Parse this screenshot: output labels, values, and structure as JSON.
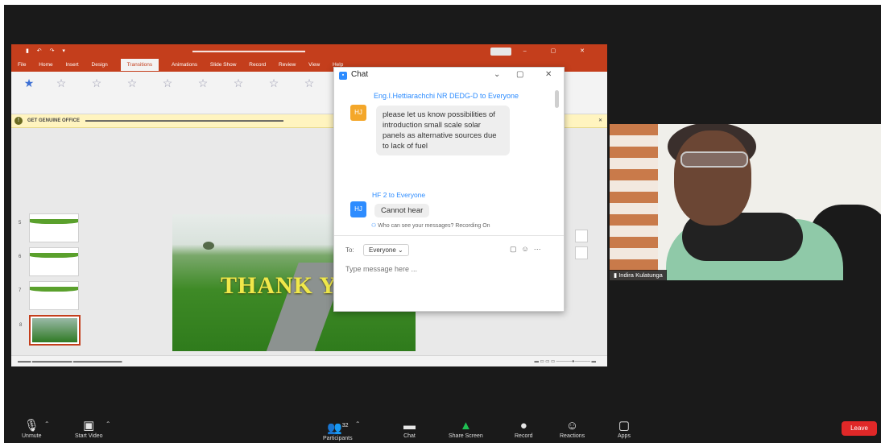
{
  "powerpoint": {
    "tabs": [
      "File",
      "Home",
      "Insert",
      "Design",
      "Transitions",
      "Animations",
      "Slide Show",
      "Record",
      "Review",
      "View",
      "Help"
    ],
    "infobar_title": "GET GENUINE OFFICE",
    "slide_text": "THANK YOU"
  },
  "chat": {
    "title": "Chat",
    "messages": [
      {
        "avatar": "HJ",
        "from": "Eng.I.Hettiarachchi NR DEDG-D to Everyone",
        "text": "please let us know possibilities of introduction small scale solar panels as alternative sources due to lack of fuel"
      },
      {
        "avatar": "HJ",
        "from": "HF 2 to Everyone",
        "text": "Cannot hear"
      }
    ],
    "visibility_note": "Who can see your messages? Recording On",
    "to_label": "To:",
    "to_value": "Everyone",
    "input_placeholder": "Type message here ..."
  },
  "participant": {
    "name": "Indira Kulatunga"
  },
  "toolbar": {
    "items": [
      {
        "icon": "microphone-icon",
        "label": "Unmute"
      },
      {
        "icon": "video-camera-icon",
        "label": "Start Video"
      },
      {
        "icon": "participants-icon",
        "label": "Participants",
        "count": "32"
      },
      {
        "icon": "chat-icon",
        "label": "Chat"
      },
      {
        "icon": "share-screen-icon",
        "label": "Share Screen"
      },
      {
        "icon": "record-icon",
        "label": "Record"
      },
      {
        "icon": "reactions-icon",
        "label": "Reactions"
      },
      {
        "icon": "apps-icon",
        "label": "Apps"
      }
    ],
    "leave_label": "Leave"
  },
  "colors": {
    "powerpoint_accent": "#c43e1c",
    "zoom_blue": "#2d8cff",
    "share_green": "#1fbf52",
    "leave_red": "#e02828"
  }
}
